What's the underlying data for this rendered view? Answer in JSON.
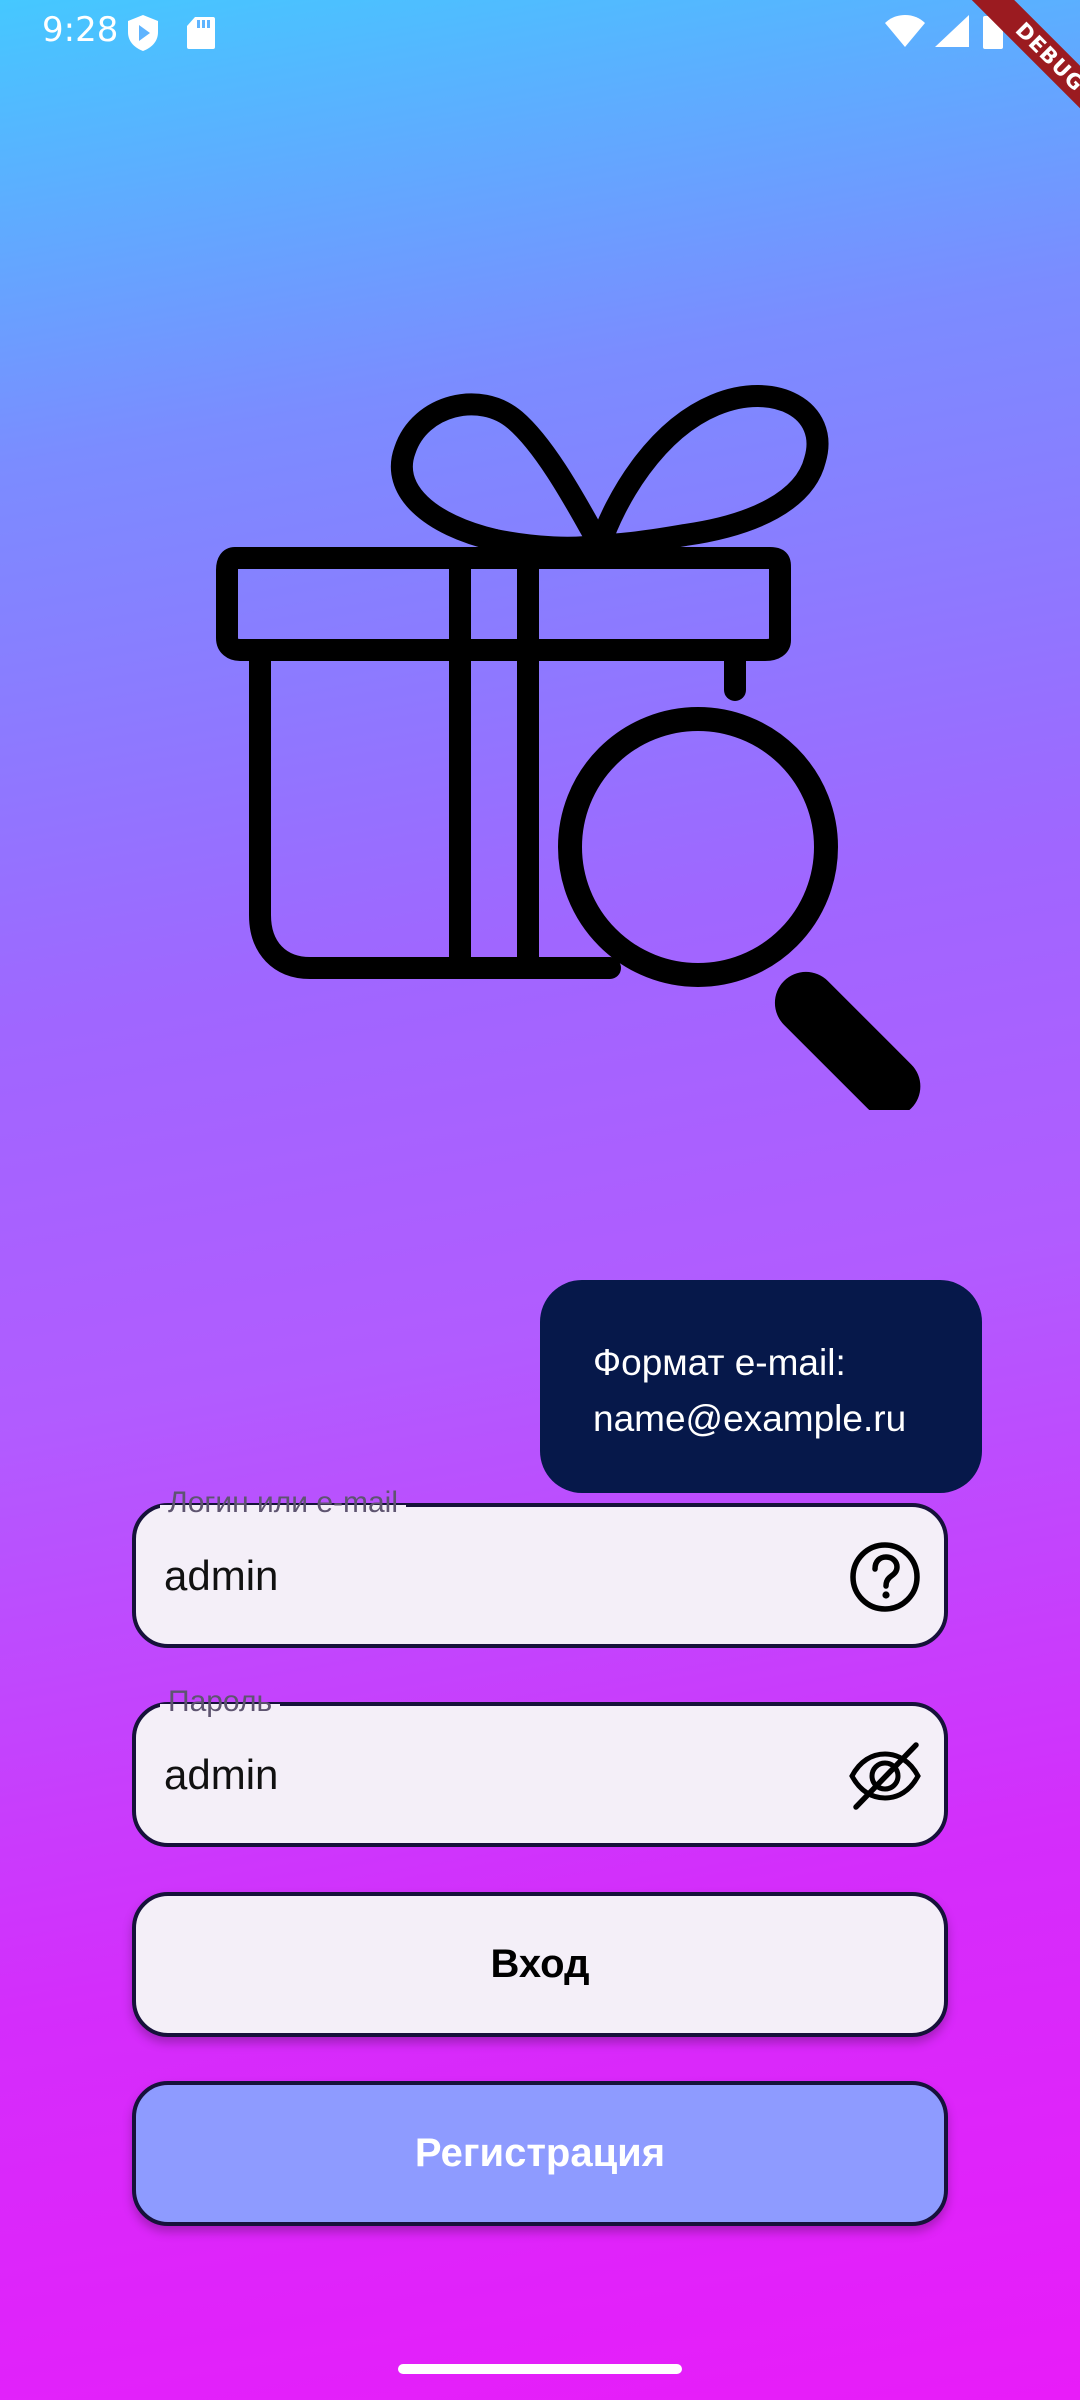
{
  "status_bar": {
    "time": "9:28",
    "icons": [
      "shield-play-icon",
      "sd-card-icon",
      "wifi-icon",
      "cell-signal-icon",
      "battery-icon"
    ]
  },
  "debug_banner": {
    "label": "DEBUG"
  },
  "logo": {
    "icon": "gift-search-icon"
  },
  "tooltip": {
    "line1": "Формат e-mail:",
    "line2": "name@example.ru"
  },
  "login_field": {
    "label": "Логин или e-mail",
    "value": "admin",
    "icon": "help-circle-icon"
  },
  "password_field": {
    "label": "Пароль",
    "value": "admin",
    "icon": "visibility-off-icon"
  },
  "buttons": {
    "login_label": "Вход",
    "register_label": "Регистрация"
  },
  "colors": {
    "gradient_top": "#45c8ff",
    "gradient_mid": "#a066ff",
    "gradient_bottom": "#e81cf9",
    "field_background": "#f4eff8",
    "border": "#16123a",
    "tooltip_background": "#06184a",
    "register_button": "#8e9bff",
    "debug_ribbon": "#9b1b20"
  }
}
